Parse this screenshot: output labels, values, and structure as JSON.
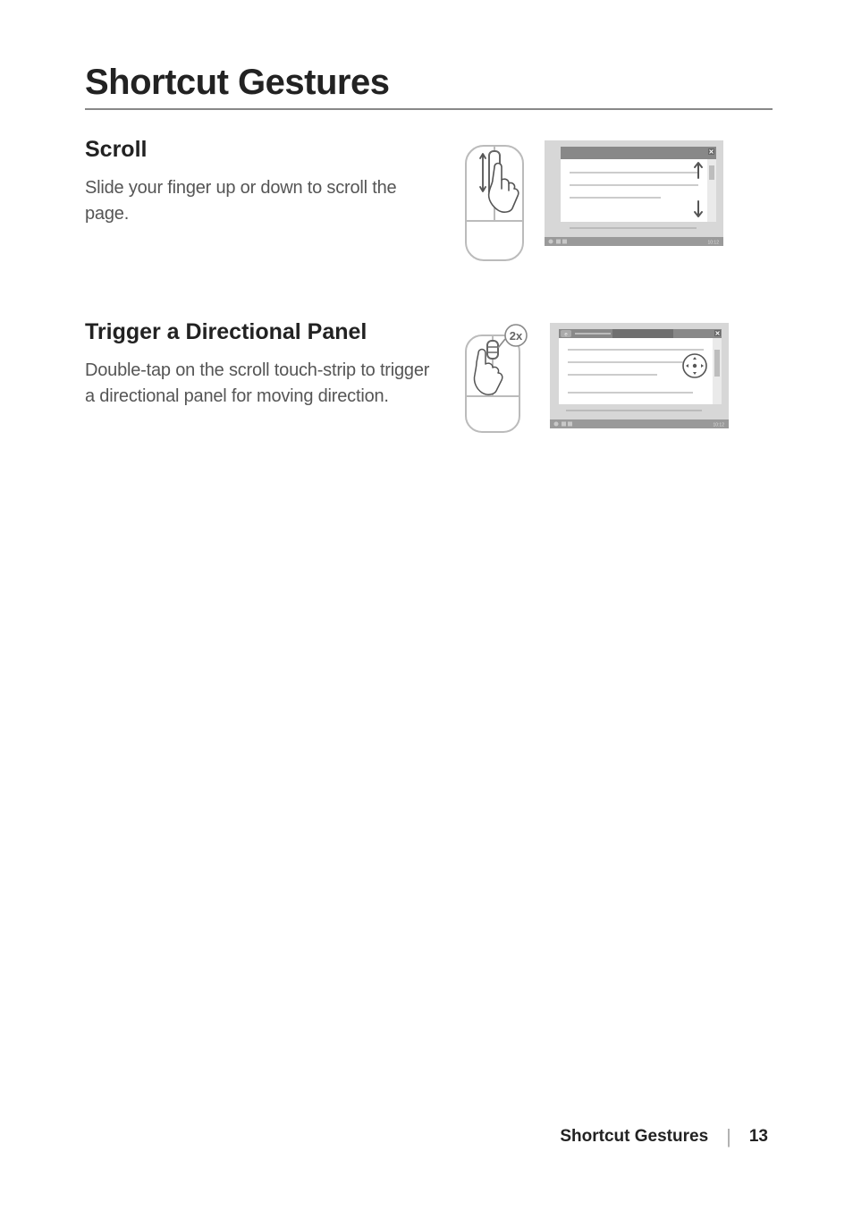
{
  "title": "Shortcut Gestures",
  "sections": [
    {
      "heading": "Scroll",
      "body": "Slide your finger up or down to scroll the page."
    },
    {
      "heading": "Trigger a Directional Panel",
      "body": "Double-tap on the scroll touch-strip to trigger a directional panel for moving direction."
    }
  ],
  "illustrations": {
    "double_tap_label": "2x",
    "taskbar_time": "10:12"
  },
  "footer": {
    "title": "Shortcut Gestures",
    "page": "13"
  }
}
